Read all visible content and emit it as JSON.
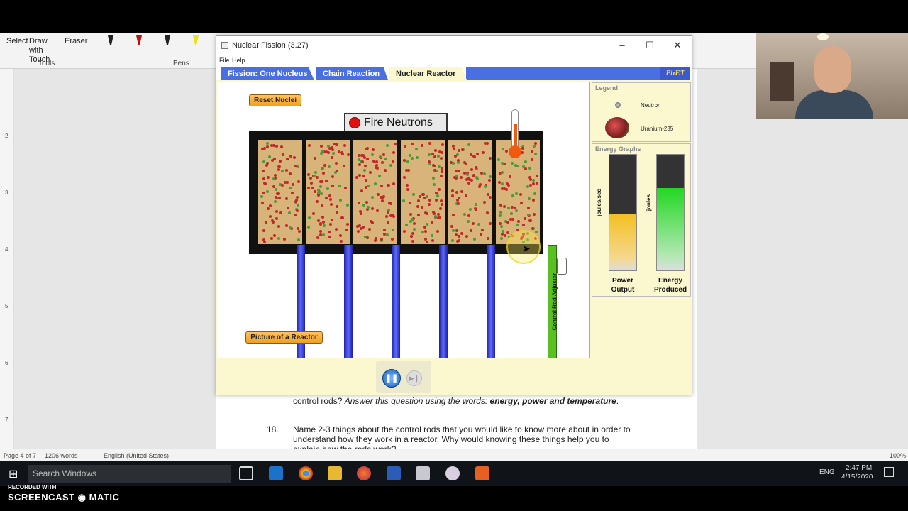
{
  "ribbon": {
    "select_label": "Select",
    "draw_label": "Draw with Touch",
    "eraser_label": "Eraser",
    "tools_group": "Tools",
    "pens_group": "Pens"
  },
  "document": {
    "line1_prefix": "control rods?",
    "line1_italic": "Answer this question using the words:",
    "line1_bold": "energy, power and temperature",
    "q18_num": "18.",
    "q18_line1": "Name 2-3 things about the control rods that you would like to know more about in order to",
    "q18_line2": "understand how they work in a reactor. Why would knowing these things help you to",
    "q18_line3": "explain how the rods work?"
  },
  "status": {
    "page": "Page 4 of 7",
    "words": "1206 words",
    "language": "English (United States)",
    "zoom": "100%"
  },
  "taskbar": {
    "search_placeholder": "Search Windows",
    "lang": "ENG",
    "time": "2:47 PM",
    "date": "4/15/2020"
  },
  "watermark": {
    "line1": "RECORDED WITH",
    "line2": "SCREENCAST ◉ MATIC"
  },
  "window": {
    "title": "Nuclear Fission (3.27)",
    "menu_file": "File",
    "menu_help": "Help",
    "tabs": [
      "Fission: One Nucleus",
      "Chain Reaction",
      "Nuclear Reactor"
    ],
    "active_tab": 2,
    "logo": "PhET"
  },
  "sim": {
    "reset_label": "Reset Nuclei",
    "fire_label": "Fire Neutrons",
    "picture_label": "Picture of a Reactor",
    "adjuster_label": "Control Rod Adjuster",
    "temperature_level": 0.55
  },
  "legend": {
    "title": "Legend",
    "neutron_label": "Neutron",
    "u235_label": "Uranium-235"
  },
  "graphs": {
    "title": "Energy Graphs",
    "power_axis": "joules/sec",
    "energy_axis": "joules",
    "power_caption_1": "Power",
    "power_caption_2": "Output",
    "energy_caption_1": "Energy",
    "energy_caption_2": "Produced",
    "power_level": 0.49,
    "energy_level": 0.71,
    "power_color": "#f4c020",
    "energy_color": "#22d822"
  },
  "colors": {
    "tab_blue": "#4a6fe0",
    "sim_bg": "#fbf8d0",
    "chamber": "#d8b47a",
    "rod_blue": "#3a4ae0",
    "adjuster_green": "#58c020"
  }
}
